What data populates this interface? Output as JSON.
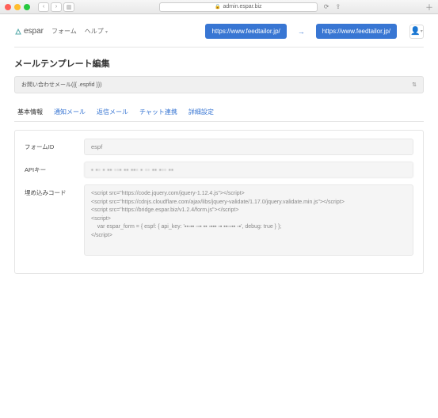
{
  "browser": {
    "url": "admin.espar.biz"
  },
  "header": {
    "brand": "espar",
    "links": {
      "forms": "フォーム",
      "help": "ヘルプ"
    },
    "buttons": {
      "url1": "https://www.feedtailor.jp/",
      "url2": "https://www.feedtailor.jp/"
    }
  },
  "page_title": "メールテンプレート編集",
  "templateSelect": {
    "label": "お問い合わせメール({{ .espfid }})"
  },
  "tabs": {
    "basic": "基本情報",
    "notify": "通知メール",
    "reply": "返信メール",
    "chat": "チャット連携",
    "advanced": "詳細設定"
  },
  "form": {
    "formId": {
      "label": "フォームID",
      "value": "espf"
    },
    "apiKey": {
      "label": "APIキー",
      "value": "▪ ▪▫  ▪ ▪▪ ▫▫▪  ▪▪  ▪▪▫ ▪  ▫▫  ▪▪  ▪▫▫  ▪▪"
    },
    "embedCode": {
      "label": "埋め込みコード",
      "value": "<script src=\"https://code.jquery.com/jquery-1.12.4.js\"></script>\n<script src=\"https://cdnjs.cloudflare.com/ajax/libs/jquery-validate/1.17.0/jquery.validate.min.js\"></script>\n<script src=\"https://bridge.espar.biz/v1.2.4/form.js\"></script>\n<script>\n    var espar_form = { espf: { api_key: '▪▪▫▪▪ ▫▫▪ ▪▪ ▫▪▪▪ ▫▪ ▪▪▫▫▪▪ ▫▪', debug: true } };\n</script>"
    }
  }
}
